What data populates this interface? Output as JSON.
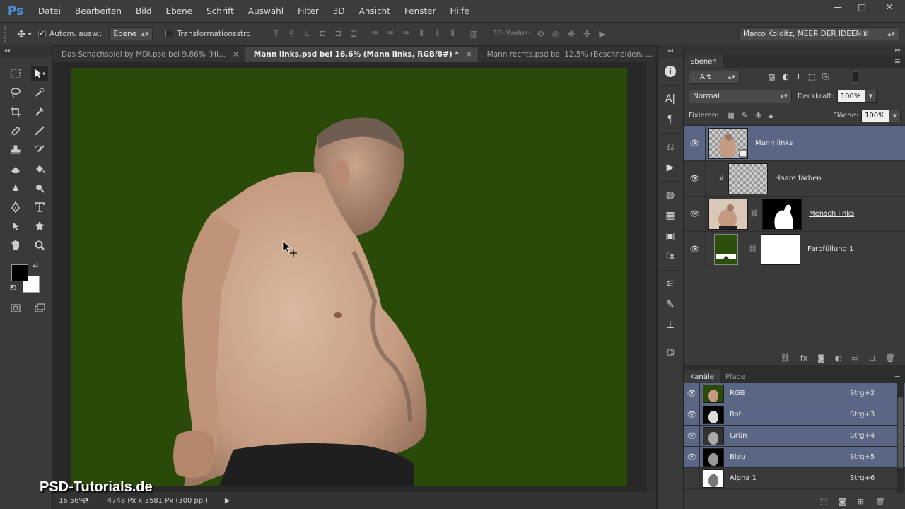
{
  "app": {
    "logo": "Ps"
  },
  "menu": [
    "Datei",
    "Bearbeiten",
    "Bild",
    "Ebene",
    "Schrift",
    "Auswahl",
    "Filter",
    "3D",
    "Ansicht",
    "Fenster",
    "Hilfe"
  ],
  "window_controls": {
    "minimize": "—",
    "maximize": "□",
    "close": "✕"
  },
  "options": {
    "auto_select_label": "Autom. ausw.:",
    "auto_select_target": "Ebene",
    "transform_label": "Transformationsstrg.",
    "mode3d_label": "3D-Modus:",
    "workspace": "Marco Kolditz, MEER DER IDEEN®"
  },
  "tabs": [
    {
      "label": "Das Schachspiel by MDI.psd bei 9,86% (Hi...",
      "close": "×",
      "active": false
    },
    {
      "label": "Mann links.psd bei 16,6% (Mann links, RGB/8#) *",
      "close": "×",
      "active": true
    },
    {
      "label": "Mann rechts.psd bei 12,5% (Beschneiden, ...",
      "close": "×",
      "active": false
    }
  ],
  "status": {
    "zoom": "16,56%",
    "doc_info": "4748 Px x 3581 Px (300 ppi)",
    "arrow": "▶"
  },
  "watermark": "PSD-Tutorials.de",
  "layers_panel": {
    "tab_label": "Ebenen",
    "filter_kind": "Art",
    "blend_mode": "Normal",
    "opacity_label": "Deckkraft:",
    "opacity_value": "100%",
    "lock_label": "Fixieren:",
    "fill_label": "Fläche:",
    "fill_value": "100%",
    "layers": [
      {
        "name": "Mann links",
        "selected": true
      },
      {
        "name": "Haare färben",
        "selected": false
      },
      {
        "name": "Mensch links",
        "selected": false
      },
      {
        "name": "Farbfüllung 1",
        "selected": false
      }
    ]
  },
  "channels_panel": {
    "tab_channels": "Kanäle",
    "tab_paths": "Pfade",
    "channels": [
      {
        "name": "RGB",
        "shortcut": "Strg+2",
        "selected": true
      },
      {
        "name": "Rot",
        "shortcut": "Strg+3",
        "selected": true
      },
      {
        "name": "Grün",
        "shortcut": "Strg+4",
        "selected": true
      },
      {
        "name": "Blau",
        "shortcut": "Strg+5",
        "selected": true
      },
      {
        "name": "Alpha 1",
        "shortcut": "Strg+6",
        "selected": false
      }
    ]
  },
  "colors": {
    "foreground": "#000000",
    "background": "#ffffff",
    "canvas_bg": "#2a4a09",
    "selection": "#5a6784"
  }
}
